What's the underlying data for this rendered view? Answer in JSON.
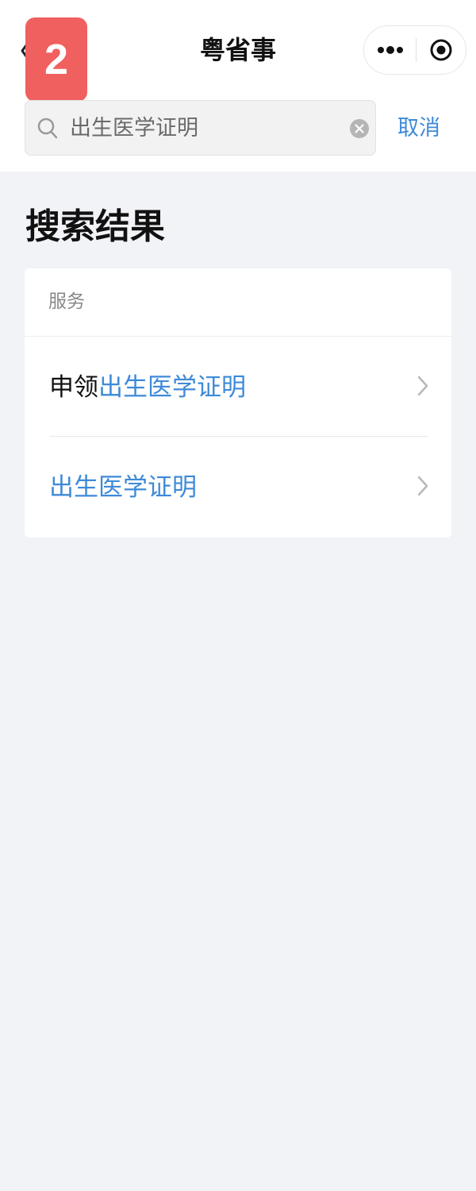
{
  "nav": {
    "badge": "2",
    "title": "粤省事"
  },
  "search": {
    "query": "出生医学证明",
    "cancel_label": "取消"
  },
  "results": {
    "title": "搜索结果",
    "section_label": "服务",
    "items": [
      {
        "prefix": "申领",
        "highlight": "出生医学证明"
      },
      {
        "prefix": "",
        "highlight": "出生医学证明"
      }
    ]
  },
  "colors": {
    "accent": "#3e8ad8",
    "badge": "#f0605f",
    "background": "#f2f3f7"
  },
  "icons": [
    "back-icon",
    "more-icon",
    "close-circle-icon",
    "search-icon",
    "clear-icon",
    "chevron-right-icon"
  ]
}
